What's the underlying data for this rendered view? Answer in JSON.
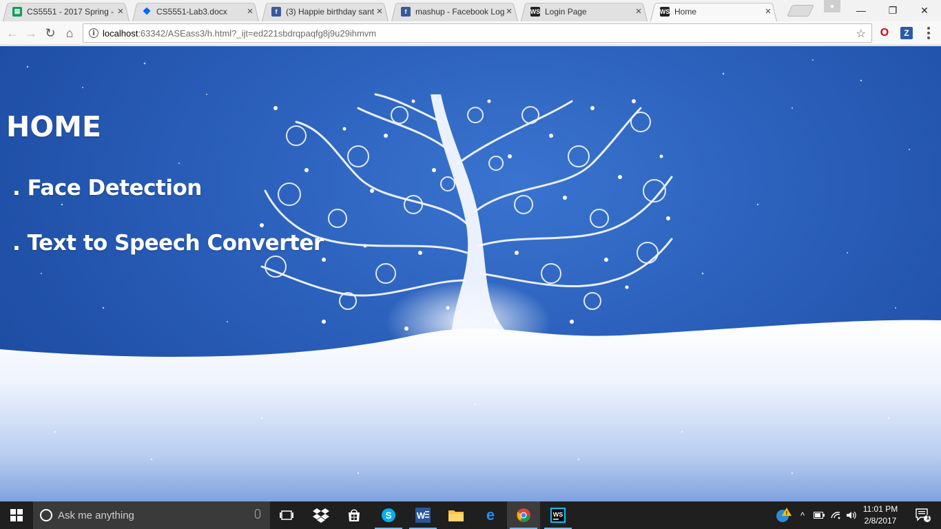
{
  "browser": {
    "tabs": [
      {
        "title": "CS5551 - 2017 Spring -",
        "favicon": "sheets-icon",
        "active": false
      },
      {
        "title": "CS5551-Lab3.docx",
        "favicon": "dropbox-icon",
        "active": false
      },
      {
        "title": "(3) Happie birthday sant",
        "favicon": "facebook-icon",
        "active": false
      },
      {
        "title": "mashup - Facebook Log",
        "favicon": "facebook-icon",
        "active": false
      },
      {
        "title": "Login Page",
        "favicon": "webstorm-icon",
        "active": false
      },
      {
        "title": "Home",
        "favicon": "webstorm-icon",
        "active": true
      }
    ],
    "url": {
      "host": "localhost",
      "rest": ":63342/ASEass3/h.html?_ijt=ed221sbdrqpaqfg8j9u29ihmvm"
    }
  },
  "page": {
    "heading": "HOME",
    "links": [
      ". Face Detection",
      ". Text to Speech Converter"
    ]
  },
  "taskbar": {
    "search_placeholder": "Ask me anything",
    "time": "11:01 PM",
    "date": "2/8/2017",
    "notification_count": "1",
    "apps": [
      "task-view-icon",
      "dropbox-icon",
      "store-icon",
      "skype-icon",
      "word-icon",
      "file-explorer-icon",
      "edge-icon",
      "chrome-icon",
      "webstorm-icon"
    ]
  },
  "colors": {
    "sky": "#2a5fba",
    "snow": "#eef3fd",
    "taskbar": "#1f1f1f"
  }
}
